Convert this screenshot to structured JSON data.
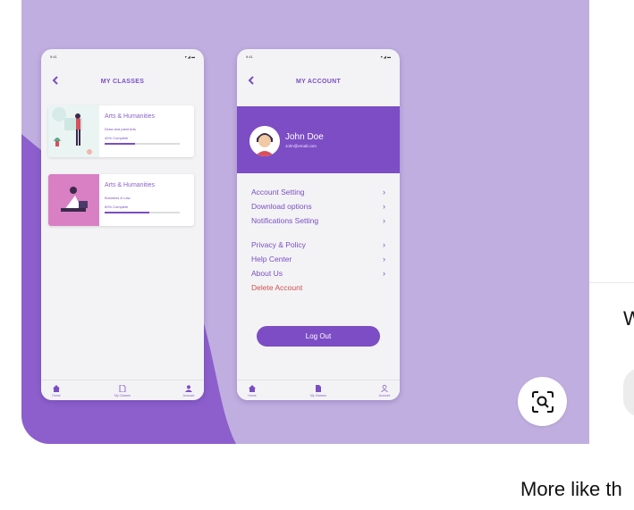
{
  "screen_left": {
    "status_time": "9:41",
    "title": "MY CLASSES",
    "classes": [
      {
        "title": "Arts & Humanities",
        "subtitle": "Draw and paint Arts",
        "progress_text": "40% Complete",
        "progress": 0.4
      },
      {
        "title": "Arts & Humanities",
        "subtitle": "Business & Law",
        "progress_text": "60% Complete",
        "progress": 0.6
      }
    ],
    "tabs": [
      "Home",
      "My Classes",
      "Account"
    ]
  },
  "screen_right": {
    "status_time": "9:41",
    "title": "MY ACCOUNT",
    "user_name": "John Doe",
    "user_email": "John@email.com",
    "menu": [
      {
        "label": "Account Setting",
        "chevron": "›"
      },
      {
        "label": "Download options",
        "chevron": "›"
      },
      {
        "label": "Notifications Setting",
        "chevron": "›"
      },
      {
        "label": "Privacy & Policy",
        "chevron": "›"
      },
      {
        "label": "Help Center",
        "chevron": "›"
      },
      {
        "label": "About Us",
        "chevron": "›"
      }
    ],
    "delete_label": "Delete Account",
    "logout_label": "Log Out",
    "tabs": [
      "Home",
      "My Classes",
      "Account"
    ]
  },
  "side_panel": {
    "partial_heading": "W"
  },
  "more_like_this": "More like th",
  "icons": {
    "back": "chevron-left-icon",
    "visual_search": "visual-search-icon",
    "home": "home-icon",
    "classes": "document-icon",
    "account": "user-icon"
  },
  "colors": {
    "card_bg": "#c0aee0",
    "wave": "#8c5fcc",
    "accent": "#7c4dc4",
    "danger": "#d05050"
  }
}
